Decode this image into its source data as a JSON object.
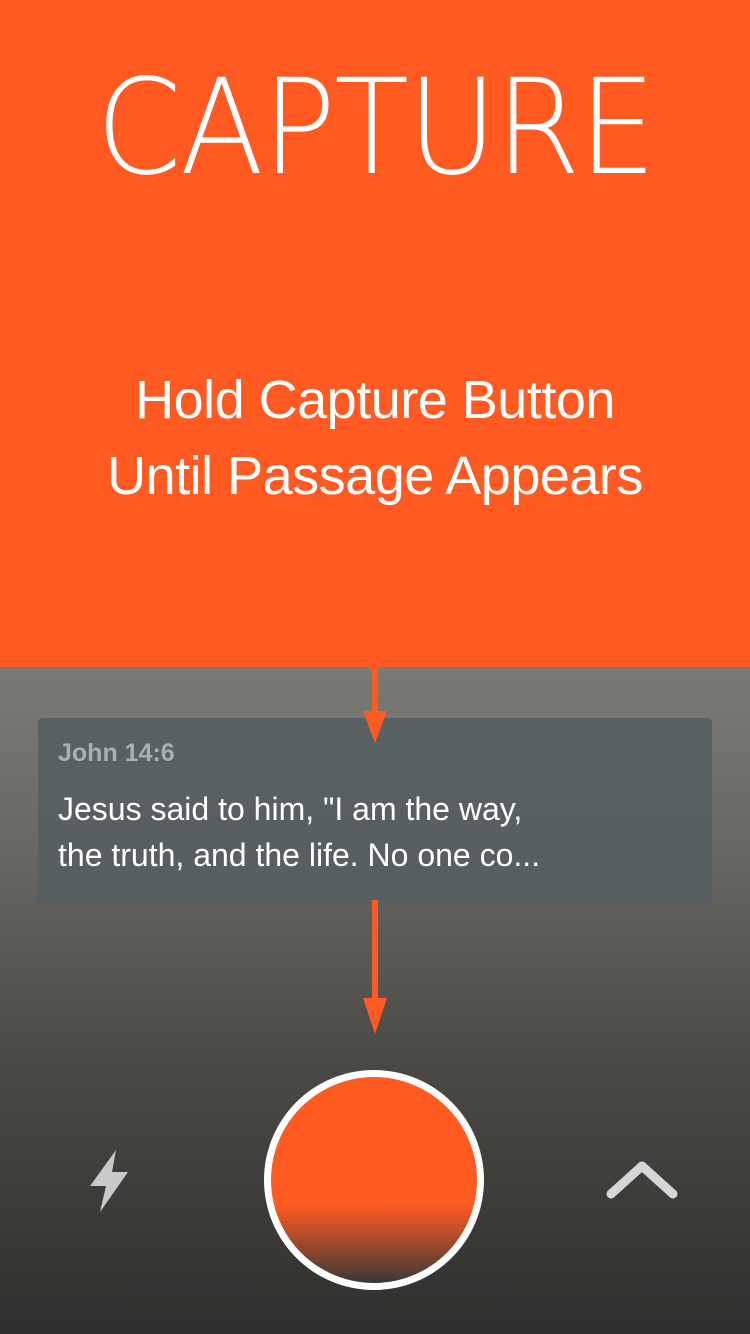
{
  "hero": {
    "title": "CAPTURE",
    "subtitle_line1": "Hold Capture Button",
    "subtitle_line2": "Until Passage Appears",
    "background_color": "#FF5A22"
  },
  "passage_card": {
    "reference": "John 14:6",
    "text_line1": "Jesus said to him, \"I am the way,",
    "text_line2": "the truth, and the life. No one co..."
  },
  "controls": {
    "flash_icon": "lightning-bolt-icon",
    "capture_button_color": "#FF5A22",
    "expand_icon": "chevron-up-icon"
  }
}
